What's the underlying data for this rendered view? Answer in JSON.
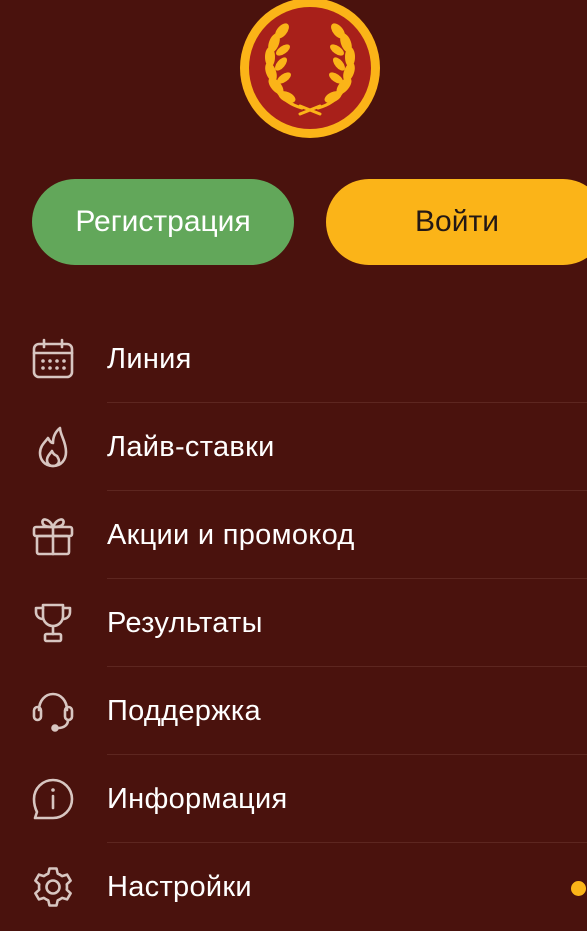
{
  "brand": {
    "logo_icon": "laurel-wreath-logo",
    "colors": {
      "background": "#4a120d",
      "logo_inner": "#a8201a",
      "logo_ring": "#fbb418",
      "register": "#62a75a",
      "login": "#fbb418",
      "icon": "#d8c6c1"
    }
  },
  "auth": {
    "register_label": "Регистрация",
    "login_label": "Войти"
  },
  "menu": {
    "items": [
      {
        "label": "Линия",
        "icon": "calendar-icon"
      },
      {
        "label": "Лайв-ставки",
        "icon": "fire-icon"
      },
      {
        "label": "Акции и промокод",
        "icon": "gift-icon"
      },
      {
        "label": "Результаты",
        "icon": "trophy-icon"
      },
      {
        "label": "Поддержка",
        "icon": "headset-icon"
      },
      {
        "label": "Информация",
        "icon": "info-icon"
      },
      {
        "label": "Настройки",
        "icon": "gear-icon",
        "has_notification": true
      }
    ]
  }
}
